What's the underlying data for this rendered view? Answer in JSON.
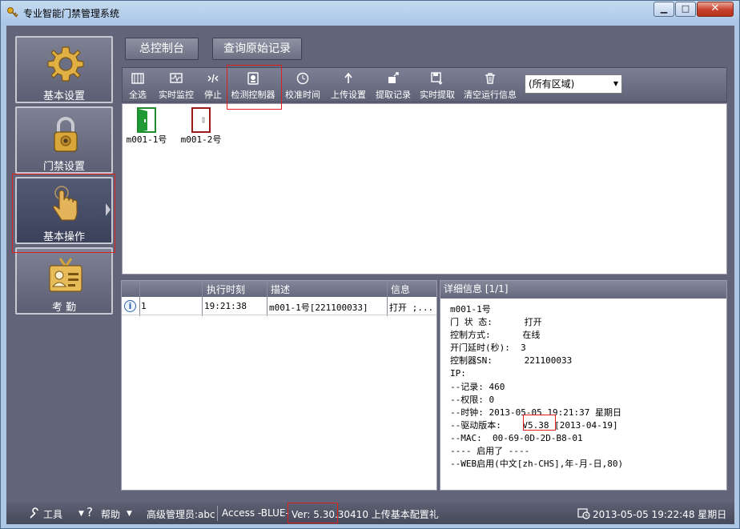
{
  "window": {
    "title": "专业智能门禁管理系统"
  },
  "nav": {
    "items": [
      {
        "label": "基本设置",
        "icon": "gear-icon"
      },
      {
        "label": "门禁设置",
        "icon": "padlock-icon"
      },
      {
        "label": "基本操作",
        "icon": "hand-pointer-icon",
        "active": true
      },
      {
        "label": "考  勤",
        "icon": "id-badge-icon"
      }
    ]
  },
  "top_buttons": {
    "console": "总控制台",
    "query_records": "查询原始记录"
  },
  "toolbar": {
    "items": [
      {
        "label": "全选",
        "icon": "select-all-icon"
      },
      {
        "label": "实时监控",
        "icon": "monitor-icon"
      },
      {
        "label": "停止",
        "icon": "stop-icon"
      },
      {
        "label": "检测控制器",
        "icon": "detect-controller-icon"
      },
      {
        "label": "校准时间",
        "icon": "clock-icon"
      },
      {
        "label": "上传设置",
        "icon": "upload-icon"
      },
      {
        "label": "提取记录",
        "icon": "extract-records-icon"
      },
      {
        "label": "实时提取",
        "icon": "realtime-extract-icon"
      },
      {
        "label": "清空运行信息",
        "icon": "trash-icon"
      }
    ],
    "zone_select": "(所有区域)"
  },
  "doors": [
    {
      "label": "m001-1号",
      "state": "open"
    },
    {
      "label": "m001-2号",
      "state": "closed"
    }
  ],
  "log": {
    "headers": [
      "执行时刻",
      "描述",
      "信息"
    ],
    "rows": [
      {
        "index": "1",
        "time": "19:21:38",
        "desc": "m001-1号[221100033]",
        "info": "打开 ;..."
      }
    ]
  },
  "detail": {
    "title": "详细信息  [1/1]",
    "lines": [
      "m001-1号",
      "门 状 态:      打开",
      "控制方式:      在线",
      "开门延时(秒):  3",
      "控制器SN:      221100033",
      "IP:",
      "--记录: 460",
      "--权限: 0",
      "--时钟: 2013-05-05 19:21:37 星期日",
      "--驱动版本:    V5.38 [2013-04-19]",
      "--MAC:  00-69-0D-2D-B8-01",
      "---- 启用了 ----",
      "--WEB启用(中文[zh-CHS],年-月-日,80)"
    ]
  },
  "status": {
    "tools": "工具",
    "help": "帮助",
    "user": "高级管理员:abc",
    "db": "Access -BLUE-",
    "version": "Ver: 5.30.30410 上传基本配置礼",
    "datetime": "2013-05-05 19:22:48 星期日"
  },
  "colors": {
    "panel": "#62657a",
    "titlebar": "#a9c5e6",
    "highlight": "#e0201c"
  }
}
